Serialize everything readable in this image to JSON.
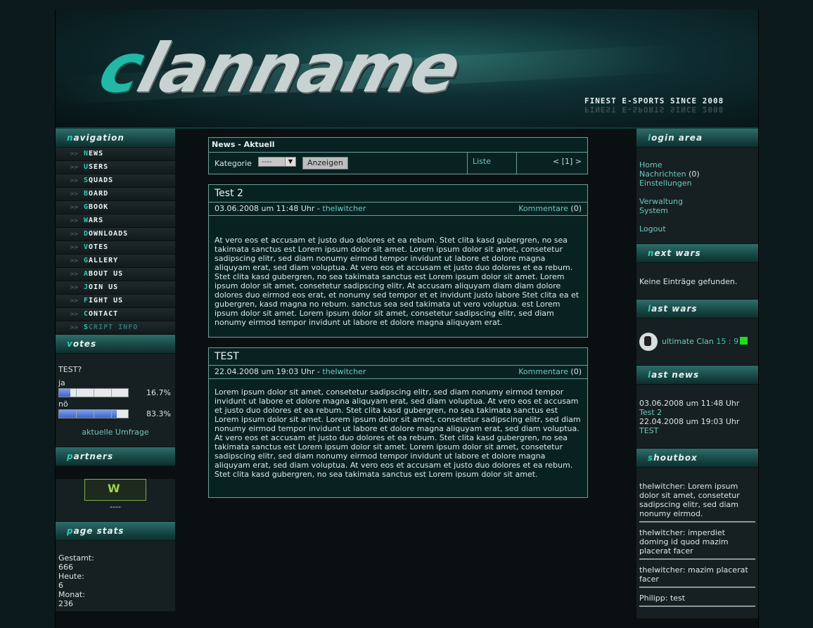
{
  "header": {
    "logo_first": "c",
    "logo_rest": "lanname",
    "tagline": "FINEST E-SPORTS SINCE 2008"
  },
  "nav": {
    "title": "navigation",
    "items": [
      "NEWS",
      "USERS",
      "SQUADS",
      "BOARD",
      "GBOOK",
      "WARS",
      "DOWNLOADS",
      "VOTES",
      "GALLERY",
      "ABOUT US",
      "JOIN US",
      "FIGHT US",
      "CONTACT",
      "SCRIPT INFO"
    ]
  },
  "votes": {
    "title": "votes",
    "question": "TEST?",
    "options": [
      {
        "label": "ja",
        "percent": 16.7,
        "pct_text": "16.7%"
      },
      {
        "label": "nö",
        "percent": 83.3,
        "pct_text": "83.3%"
      }
    ],
    "link": "aktuelle Umfrage"
  },
  "partners": {
    "title": "partners",
    "caption": "----"
  },
  "stats": {
    "title": "page stats",
    "lines": [
      "Gestamt:",
      "666",
      "Heute:",
      "6",
      "Monat:",
      "236"
    ]
  },
  "newsbar": {
    "title": "News - Aktuell",
    "kategorie_label": "Kategorie",
    "select_value": "----",
    "button": "Anzeigen",
    "liste": "Liste",
    "pager": "< [1] >"
  },
  "news": [
    {
      "title": "Test 2",
      "date": "03.06.2008 um 11:48 Uhr - ",
      "author": "theIwitcher",
      "comments_label": "Kommentare",
      "comments_count": " (0)",
      "text": "At vero eos et accusam et justo duo dolores et ea rebum. Stet clita kasd gubergren, no sea takimata sanctus est Lorem ipsum dolor sit amet. Lorem ipsum dolor sit amet, consetetur sadipscing elitr, sed diam nonumy eirmod tempor invidunt ut labore et dolore magna aliquyam erat, sed diam voluptua. At vero eos et accusam et justo duo dolores et ea rebum. Stet clita kasd gubergren, no sea takimata sanctus est Lorem ipsum dolor sit amet. Lorem ipsum dolor sit amet, consetetur sadipscing elitr, At accusam aliquyam diam diam dolore dolores duo eirmod eos erat, et nonumy sed tempor et et invidunt justo labore Stet clita ea et gubergren, kasd magna no rebum. sanctus sea sed takimata ut vero voluptua. est Lorem ipsum dolor sit amet. Lorem ipsum dolor sit amet, consetetur sadipscing elitr, sed diam nonumy eirmod tempor invidunt ut labore et dolore magna aliquyam erat."
    },
    {
      "title": "TEST",
      "date": "22.04.2008 um 19:03 Uhr - ",
      "author": "theIwitcher",
      "comments_label": "Kommentare",
      "comments_count": " (0)",
      "text": "Lorem ipsum dolor sit amet, consetetur sadipscing elitr, sed diam nonumy eirmod tempor invidunt ut labore et dolore magna aliquyam erat, sed diam voluptua. At vero eos et accusam et justo duo dolores et ea rebum. Stet clita kasd gubergren, no sea takimata sanctus est Lorem ipsum dolor sit amet. Lorem ipsum dolor sit amet, consetetur sadipscing elitr, sed diam nonumy eirmod tempor invidunt ut labore et dolore magna aliquyam erat, sed diam voluptua. At vero eos et accusam et justo duo dolores et ea rebum. Stet clita kasd gubergren, no sea takimata sanctus est Lorem ipsum dolor sit amet. Lorem ipsum dolor sit amet, consetetur sadipscing elitr, sed diam nonumy eirmod tempor invidunt ut labore et dolore magna aliquyam erat, sed diam voluptua. At vero eos et accusam et justo duo dolores et ea rebum. Stet clita kasd gubergren, no sea takimata sanctus est Lorem ipsum dolor sit amet."
    }
  ],
  "login": {
    "title": "login area",
    "home": "Home",
    "nachrichten": "Nachrichten",
    "nachrichten_count": " (0)",
    "einstellungen": "Einstellungen",
    "verwaltung": "Verwaltung",
    "system": "System",
    "logout": "Logout"
  },
  "nextwars": {
    "title": "next wars",
    "empty": "Keine Einträge gefunden."
  },
  "lastwars": {
    "title": "last wars",
    "opponent": "ultimate Clan",
    "score": "15 : 9"
  },
  "lastnews": {
    "title": "last news",
    "items": [
      {
        "date": "03.06.2008 um 11:48 Uhr",
        "title": "Test 2"
      },
      {
        "date": "22.04.2008 um 19:03 Uhr",
        "title": "TEST"
      }
    ]
  },
  "shoutbox": {
    "title": "shoutbox",
    "items": [
      "theIwitcher: Lorem ipsum dolor sit amet, consetetur sadipscing elitr, sed diam nonumy eirmod.",
      "theIwitcher: imperdiet doming id quod mazim placerat facer",
      "theIwitcher: mazim placerat facer",
      "Philipp: test"
    ]
  }
}
